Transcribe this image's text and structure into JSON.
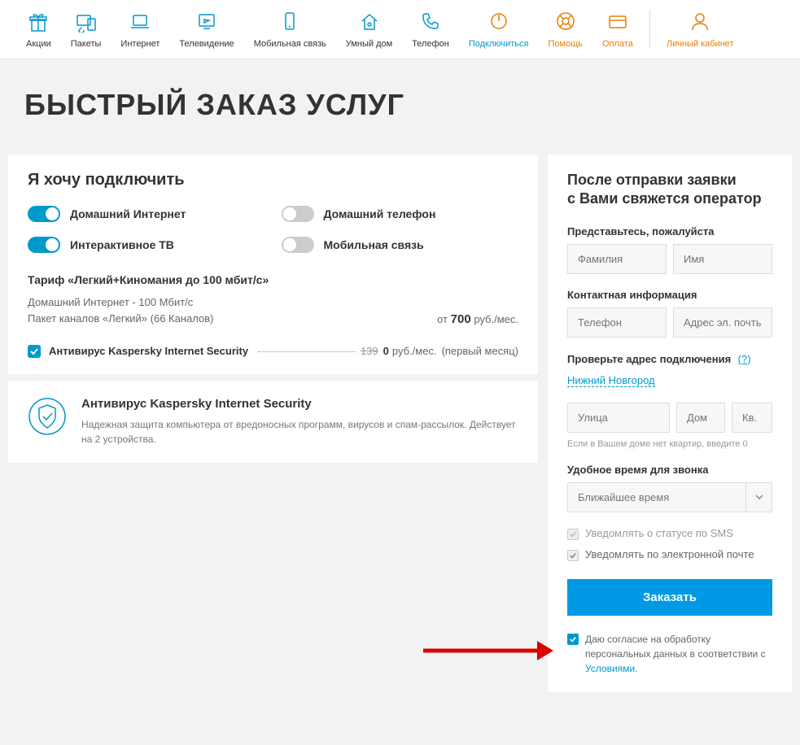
{
  "nav": [
    {
      "label": "Акции",
      "icon": "gift",
      "accent": false
    },
    {
      "label": "Пакеты",
      "icon": "devices",
      "accent": false
    },
    {
      "label": "Интернет",
      "icon": "laptop",
      "accent": false
    },
    {
      "label": "Телевидение",
      "icon": "tv",
      "accent": false
    },
    {
      "label": "Мобильная связь",
      "icon": "mobile",
      "accent": false
    },
    {
      "label": "Умный дом",
      "icon": "home",
      "accent": false
    },
    {
      "label": "Телефон",
      "icon": "phone",
      "accent": false
    },
    {
      "label": "Подключиться",
      "icon": "power",
      "accent": true,
      "blue": true
    },
    {
      "label": "Помощь",
      "icon": "lifebuoy",
      "accent": true
    },
    {
      "label": "Оплата",
      "icon": "card",
      "accent": true
    },
    {
      "label": "Личный кабинет",
      "icon": "user",
      "accent": true
    }
  ],
  "page_title": "БЫСТРЫЙ ЗАКАЗ УСЛУГ",
  "connect": {
    "title": "Я хочу подключить",
    "toggles": [
      {
        "label": "Домашний Интернет",
        "on": true
      },
      {
        "label": "Домашний телефон",
        "on": false
      },
      {
        "label": "Интерактивное ТВ",
        "on": true
      },
      {
        "label": "Мобильная связь",
        "on": false
      }
    ]
  },
  "tariff": {
    "name": "Тариф «Легкий+Киномания до 100 мбит/с»",
    "line1": "Домашний Интернет - 100 Мбит/с",
    "line2": "Пакет каналов «Легкий» (66 Каналов)",
    "price_prefix": "от",
    "price_value": "700",
    "price_suffix": "руб./мес."
  },
  "addon": {
    "name": "Антивирус Kaspersky Internet Security",
    "old_price": "139",
    "price": "0",
    "suffix": "руб./мес.",
    "note": "(первый месяц)"
  },
  "info": {
    "title": "Антивирус Kaspersky Internet Security",
    "text": "Надежная защита компьютера от вредоносных программ, вирусов и спам-рассылок. Действует на 2 устройства."
  },
  "form": {
    "title_l1": "После отправки заявки",
    "title_l2": "с Вами свяжется оператор",
    "intro_label": "Представьтесь, пожалуйста",
    "lastname_ph": "Фамилия",
    "firstname_ph": "Имя",
    "contact_label": "Контактная информация",
    "phone_ph": "Телефон",
    "email_ph": "Адрес эл. почты",
    "address_label": "Проверьте адрес подключения",
    "address_help": "(?)",
    "city": "Нижний Новгород",
    "street_ph": "Улица",
    "house_ph": "Дом",
    "apt_ph": "Кв.",
    "address_hint": "Если в Вашем доме нет квартир, введите 0",
    "time_label": "Удобное время для звонка",
    "time_value": "Ближайшее время",
    "sms_label": "Уведомлять о статусе по SMS",
    "email_notify_label": "Уведомлять по электронной почте",
    "order_btn": "Заказать",
    "consent_text": "Даю согласие на обработку персональных данных в соответствии с ",
    "consent_link": "Условиями",
    "consent_dot": "."
  }
}
